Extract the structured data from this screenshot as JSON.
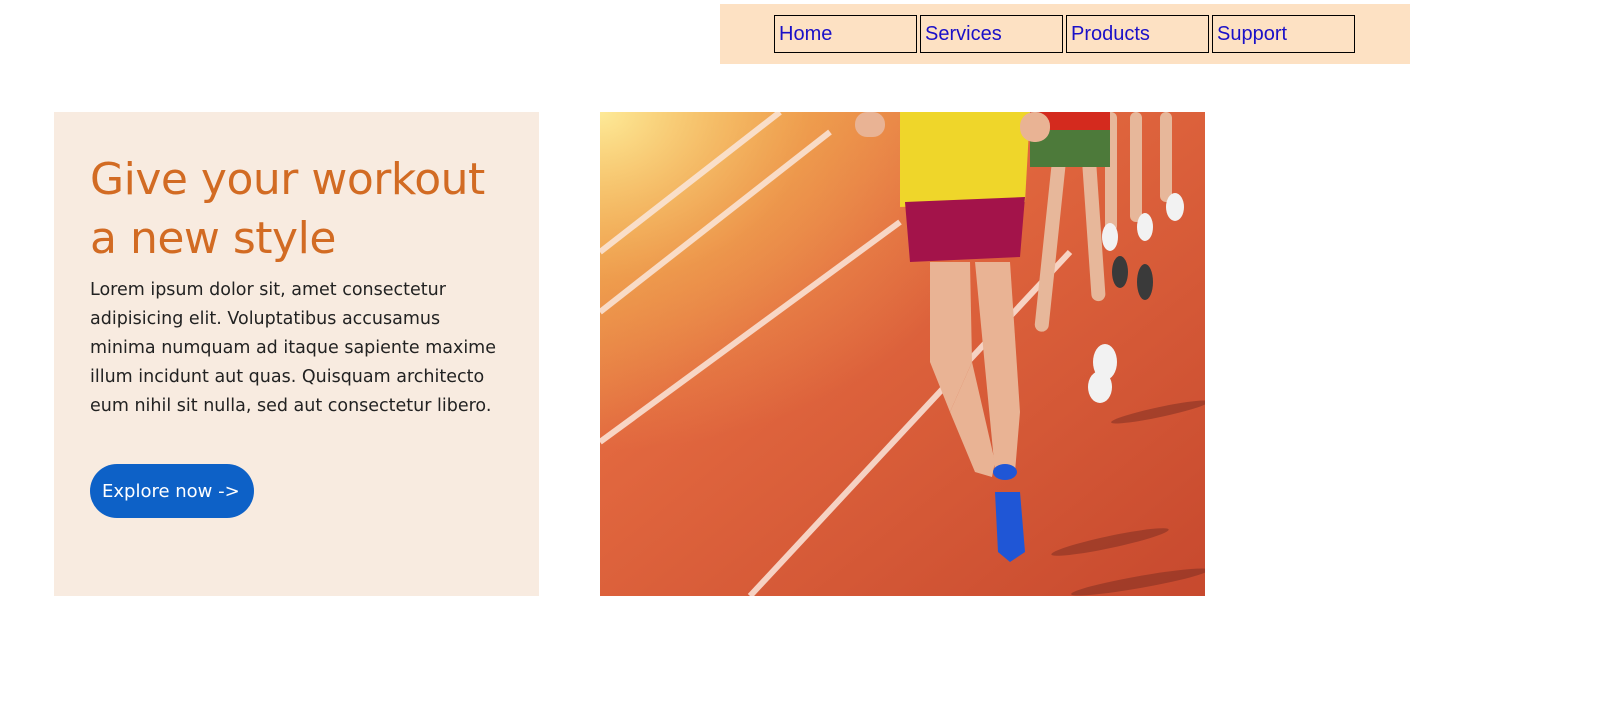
{
  "nav": {
    "items": [
      {
        "label": "Home"
      },
      {
        "label": "Services"
      },
      {
        "label": "Products"
      },
      {
        "label": "Support"
      }
    ]
  },
  "hero": {
    "title": "Give your workout a new style",
    "body": "Lorem ipsum dolor sit, amet consectetur adipisicing elit. Voluptatibus accusamus minima numquam ad itaque sapiente maxime illum incidunt aut quas. Quisquam architecto eum nihil sit nulla, sed aut consectetur libero.",
    "cta_label": "Explore now ->",
    "image": "runners-on-track-photo"
  },
  "colors": {
    "nav_bg": "#fde1c3",
    "nav_link": "#1a10c8",
    "card_bg": "#f8ebe0",
    "title": "#d26b23",
    "cta_bg": "#0d61c7",
    "track": "#d95c3b"
  }
}
